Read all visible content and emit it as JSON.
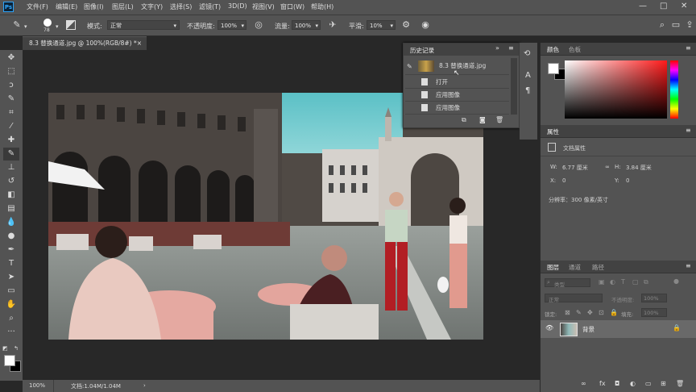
{
  "menu": {
    "app_icon": "Ps",
    "items": [
      "文件(F)",
      "编辑(E)",
      "图像(I)",
      "图层(L)",
      "文字(Y)",
      "选择(S)",
      "滤镜(T)",
      "3D(D)",
      "视图(V)",
      "窗口(W)",
      "帮助(H)"
    ],
    "window_controls": [
      "—",
      "□",
      "✕"
    ]
  },
  "options": {
    "brush_size": "78",
    "mode_label": "模式:",
    "mode_value": "正常",
    "opacity_label": "不透明度:",
    "opacity_value": "100%",
    "flow_label": "流量:",
    "flow_value": "100%",
    "smooth_label": "平滑:",
    "smooth_value": "10%"
  },
  "document": {
    "tab_title": "8.3 替换通道.jpg @ 100%(RGB/8#) *",
    "tab_close": "×"
  },
  "history": {
    "title": "历史记录",
    "snapshot_name": "8.3 替换通道.jpg",
    "steps": [
      "打开",
      "应用图像",
      "应用图像"
    ]
  },
  "color_panel": {
    "tabs": [
      "颜色",
      "色板"
    ],
    "accent": "#ff1a1a"
  },
  "properties": {
    "tab": "属性",
    "doc_props": "文档属性",
    "w_label": "W:",
    "w_value": "6.77 厘米",
    "h_label": "H:",
    "h_value": "3.84 厘米",
    "x_label": "X:",
    "x_value": "0",
    "y_label": "Y:",
    "y_value": "0",
    "resolution": "分辨率：300 像素/英寸"
  },
  "layers": {
    "tabs": [
      "图层",
      "通道",
      "路径"
    ],
    "filter_label": "类型",
    "blend_mode": "正常",
    "opacity_label": "不透明度:",
    "opacity_value": "100%",
    "lock_label": "锁定:",
    "fill_label": "填充:",
    "fill_value": "100%",
    "layer_name": "背景"
  },
  "status": {
    "zoom": "100%",
    "doc_info": "文档:1.04M/1.04M"
  }
}
